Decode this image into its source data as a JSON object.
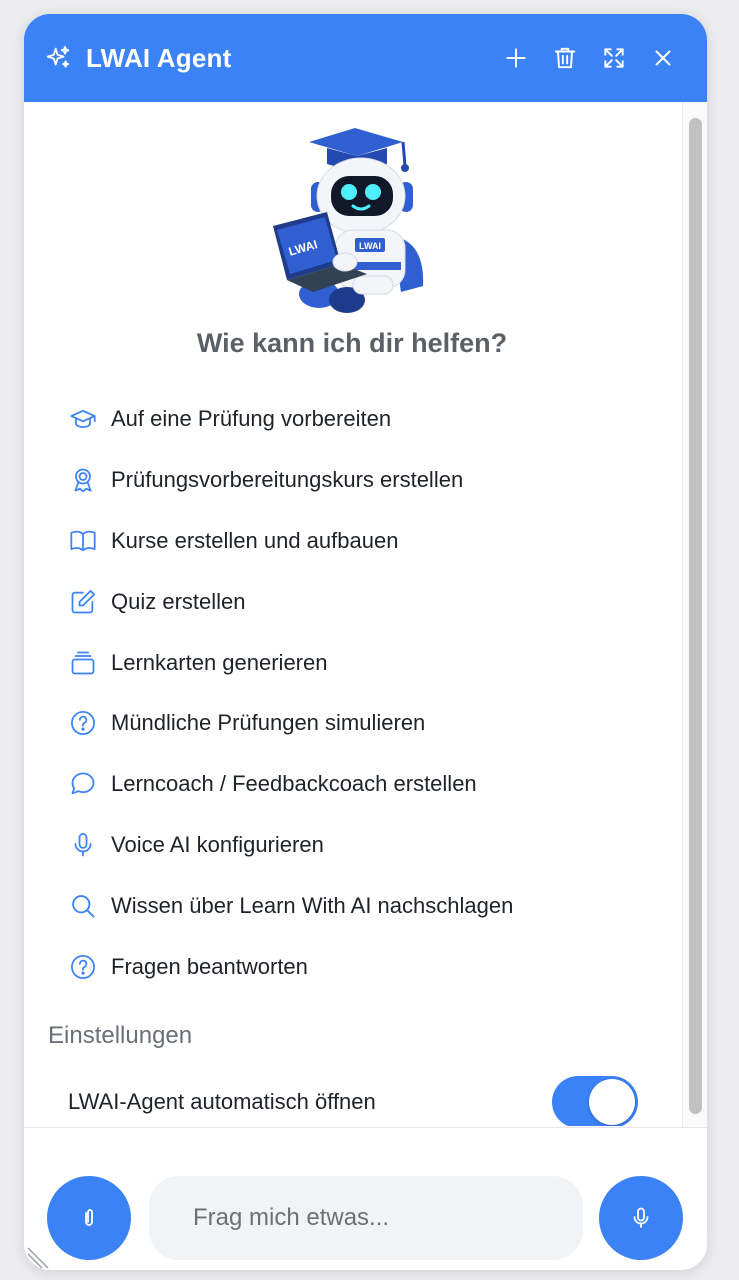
{
  "header": {
    "title": "LWAI Agent",
    "actions": [
      "plus-icon",
      "trash-icon",
      "expand-icon",
      "close-icon"
    ]
  },
  "greeting": "Wie kann ich dir helfen?",
  "options": [
    {
      "label": "Auf eine Prüfung vorbereiten",
      "icon": "graduation-cap-icon"
    },
    {
      "label": "Prüfungsvorbereitungskurs erstellen",
      "icon": "award-icon"
    },
    {
      "label": "Kurse erstellen und aufbauen",
      "icon": "book-open-icon"
    },
    {
      "label": "Quiz erstellen",
      "icon": "edit-icon"
    },
    {
      "label": "Lernkarten generieren",
      "icon": "cards-icon"
    },
    {
      "label": "Mündliche Prüfungen simulieren",
      "icon": "help-circle-icon"
    },
    {
      "label": "Lerncoach / Feedbackcoach erstellen",
      "icon": "chat-icon"
    },
    {
      "label": "Voice AI konfigurieren",
      "icon": "mic-icon"
    },
    {
      "label": "Wissen über Learn With AI nachschlagen",
      "icon": "search-icon"
    },
    {
      "label": "Fragen beantworten",
      "icon": "help-circle-icon"
    }
  ],
  "settings": {
    "title": "Einstellungen",
    "auto_open_label": "LWAI-Agent automatisch öffnen",
    "auto_open_enabled": true
  },
  "composer": {
    "placeholder": "Frag mich etwas..."
  },
  "robot_laptop_text": "LWAI",
  "robot_chest_text": "LWAI",
  "colors": {
    "accent": "#3b82f6",
    "background": "#ececef",
    "text": "#1f2328",
    "muted": "#6b6f76"
  }
}
